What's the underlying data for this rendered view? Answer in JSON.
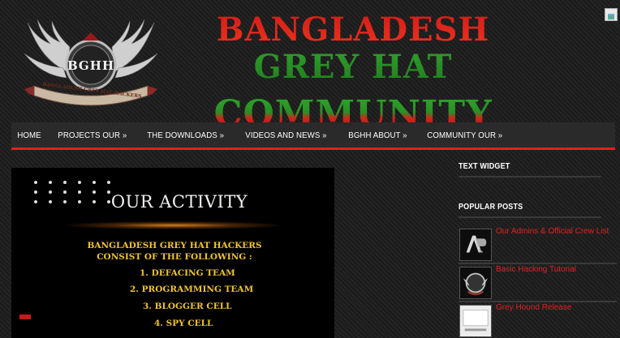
{
  "header": {
    "logo_text": "BGHH",
    "logo_banner": "BANGLADESH GREY HAT HACKERS",
    "title_line1": "Bangladesh Grey Hat",
    "title_line2": "Community"
  },
  "nav": {
    "items": [
      {
        "label": "HOME"
      },
      {
        "label": "PROJECTS OUR »"
      },
      {
        "label": "THE DOWNLOADS »"
      },
      {
        "label": "VIDEOS AND NEWS »"
      },
      {
        "label": "BGHH ABOUT »"
      },
      {
        "label": "COMMUNITY OUR »"
      }
    ],
    "accent_color": "#e02020"
  },
  "banner": {
    "title": "Our Activity",
    "intro": "BANGLADESH GREY HAT HACKERS CONSIST OF THE FOLLOWING :",
    "teams": [
      "1.  DEFACING TEAM",
      "2.  PROGRAMMING TEAM",
      "3.  BLOGGER CELL",
      "4.  SPY CELL"
    ],
    "text_color": "#f0c430"
  },
  "sidebar": {
    "text_widget_title": "TEXT WIDGET",
    "popular_title": "POPULAR POSTS",
    "posts": [
      {
        "title": "Our Admins & Official Crew List",
        "thumb_icon": "ar-logo-icon"
      },
      {
        "title": "Basic Hacking Tutorial",
        "thumb_icon": "emblem-icon"
      },
      {
        "title": "Grey Hound Release",
        "thumb_icon": "screenshot-icon"
      }
    ],
    "link_color": "#e02222"
  }
}
